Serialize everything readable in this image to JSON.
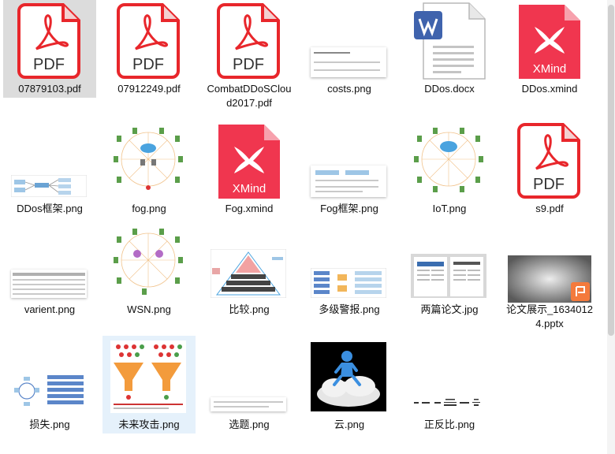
{
  "files": [
    {
      "name": "07879103.pdf",
      "icon": "pdf-icon",
      "badge": "PDF"
    },
    {
      "name": "07912249.pdf",
      "icon": "pdf-icon",
      "badge": "PDF"
    },
    {
      "name": "CombatDDoSCloud2017.pdf",
      "icon": "pdf-icon",
      "badge": "PDF"
    },
    {
      "name": "costs.png",
      "icon": "image-thumbnail-icon"
    },
    {
      "name": "DDos.docx",
      "icon": "word-document-icon"
    },
    {
      "name": "DDos.xmind",
      "icon": "xmind-icon",
      "badge": "XMind"
    },
    {
      "name": "DDos框架.png",
      "icon": "image-thumbnail-icon"
    },
    {
      "name": "fog.png",
      "icon": "network-diagram-thumbnail-icon"
    },
    {
      "name": "Fog.xmind",
      "icon": "xmind-icon",
      "badge": "XMind"
    },
    {
      "name": "Fog框架.png",
      "icon": "image-thumbnail-icon"
    },
    {
      "name": "IoT.png",
      "icon": "network-diagram-thumbnail-icon"
    },
    {
      "name": "s9.pdf",
      "icon": "pdf-icon",
      "badge": "PDF"
    },
    {
      "name": "varient.png",
      "icon": "image-thumbnail-icon"
    },
    {
      "name": "WSN.png",
      "icon": "network-diagram-thumbnail-icon"
    },
    {
      "name": "比较.png",
      "icon": "pyramid-diagram-thumbnail-icon"
    },
    {
      "name": "多级警报.png",
      "icon": "flowchart-thumbnail-icon"
    },
    {
      "name": "两篇论文.jpg",
      "icon": "paper-thumbnail-icon"
    },
    {
      "name": "论文展示_16340124.pptx",
      "icon": "powerpoint-thumbnail-icon"
    },
    {
      "name": "损失.png",
      "icon": "flowchart-thumbnail-icon"
    },
    {
      "name": "未来攻击.png",
      "icon": "funnel-diagram-thumbnail-icon"
    },
    {
      "name": "选题.png",
      "icon": "image-thumbnail-icon"
    },
    {
      "name": "云.png",
      "icon": "cloud-figure-thumbnail-icon"
    },
    {
      "name": "正反比.png",
      "icon": "formula-thumbnail-icon"
    }
  ],
  "selected_file": "07879103.pdf",
  "hovered_file": "未来攻击.png",
  "colors": {
    "pdf": "#e8262b",
    "xmind": "#f0364f",
    "word": "#3f63ad",
    "pptx": "#f47a3c",
    "selection": "#dcdcdc",
    "hover": "#e5f1fb"
  }
}
